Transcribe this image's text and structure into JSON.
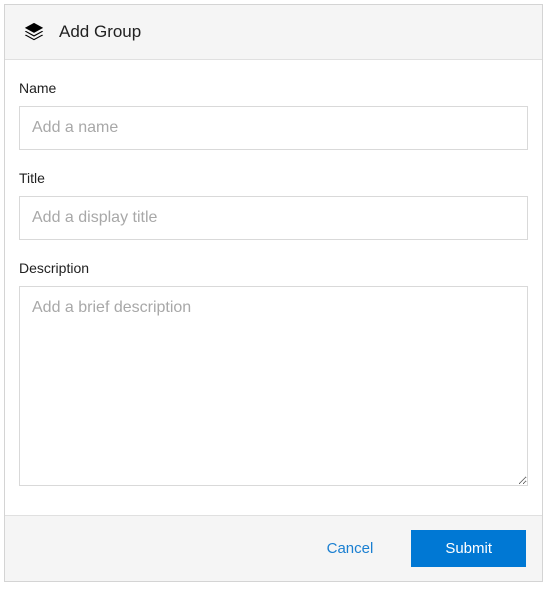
{
  "header": {
    "title": "Add Group",
    "icon": "layers-icon"
  },
  "fields": {
    "name": {
      "label": "Name",
      "value": "",
      "placeholder": "Add a name"
    },
    "title": {
      "label": "Title",
      "value": "",
      "placeholder": "Add a display title"
    },
    "description": {
      "label": "Description",
      "value": "",
      "placeholder": "Add a brief description"
    }
  },
  "footer": {
    "cancel_label": "Cancel",
    "submit_label": "Submit"
  }
}
